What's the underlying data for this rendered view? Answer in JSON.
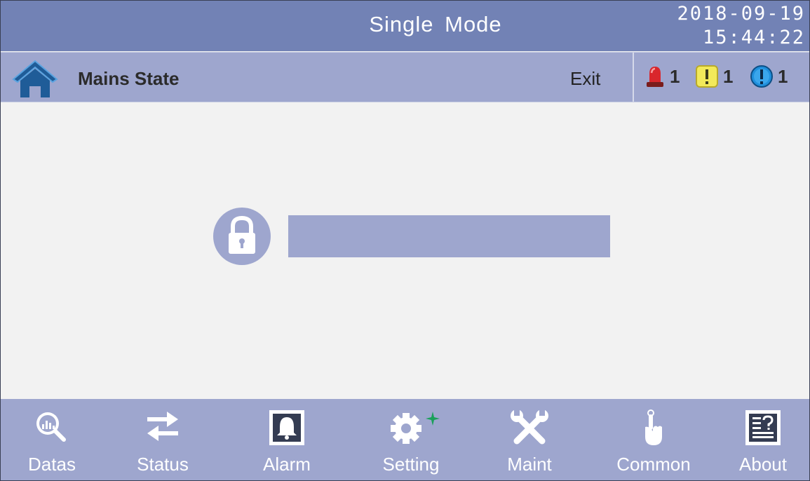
{
  "header": {
    "title": "Single Mode",
    "date": "2018-09-19",
    "time": "15:44:22"
  },
  "subbar": {
    "page_name": "Mains State",
    "exit_label": "Exit",
    "alarms": [
      {
        "type": "critical",
        "icon": "siren-icon",
        "count": "1",
        "color": "#d9262c"
      },
      {
        "type": "warning",
        "icon": "warning-icon",
        "count": "1",
        "color": "#f2e95a"
      },
      {
        "type": "info",
        "icon": "info-icon",
        "count": "1",
        "color": "#1f8fdc"
      }
    ]
  },
  "main": {
    "password_value": ""
  },
  "nav": {
    "items": [
      {
        "label": "Datas",
        "icon": "data-magnifier-icon"
      },
      {
        "label": "Status",
        "icon": "swap-arrows-icon"
      },
      {
        "label": "Alarm",
        "icon": "bell-icon"
      },
      {
        "label": "Setting",
        "icon": "gear-icon"
      },
      {
        "label": "Maint",
        "icon": "tools-icon"
      },
      {
        "label": "Common",
        "icon": "hand-pointer-icon"
      },
      {
        "label": "About",
        "icon": "about-document-icon"
      }
    ]
  },
  "colors": {
    "title_bar": "#7282b5",
    "sub_bar": "#9ea6ce",
    "background": "#f2f2f2",
    "accent_green": "#1aa05a"
  }
}
